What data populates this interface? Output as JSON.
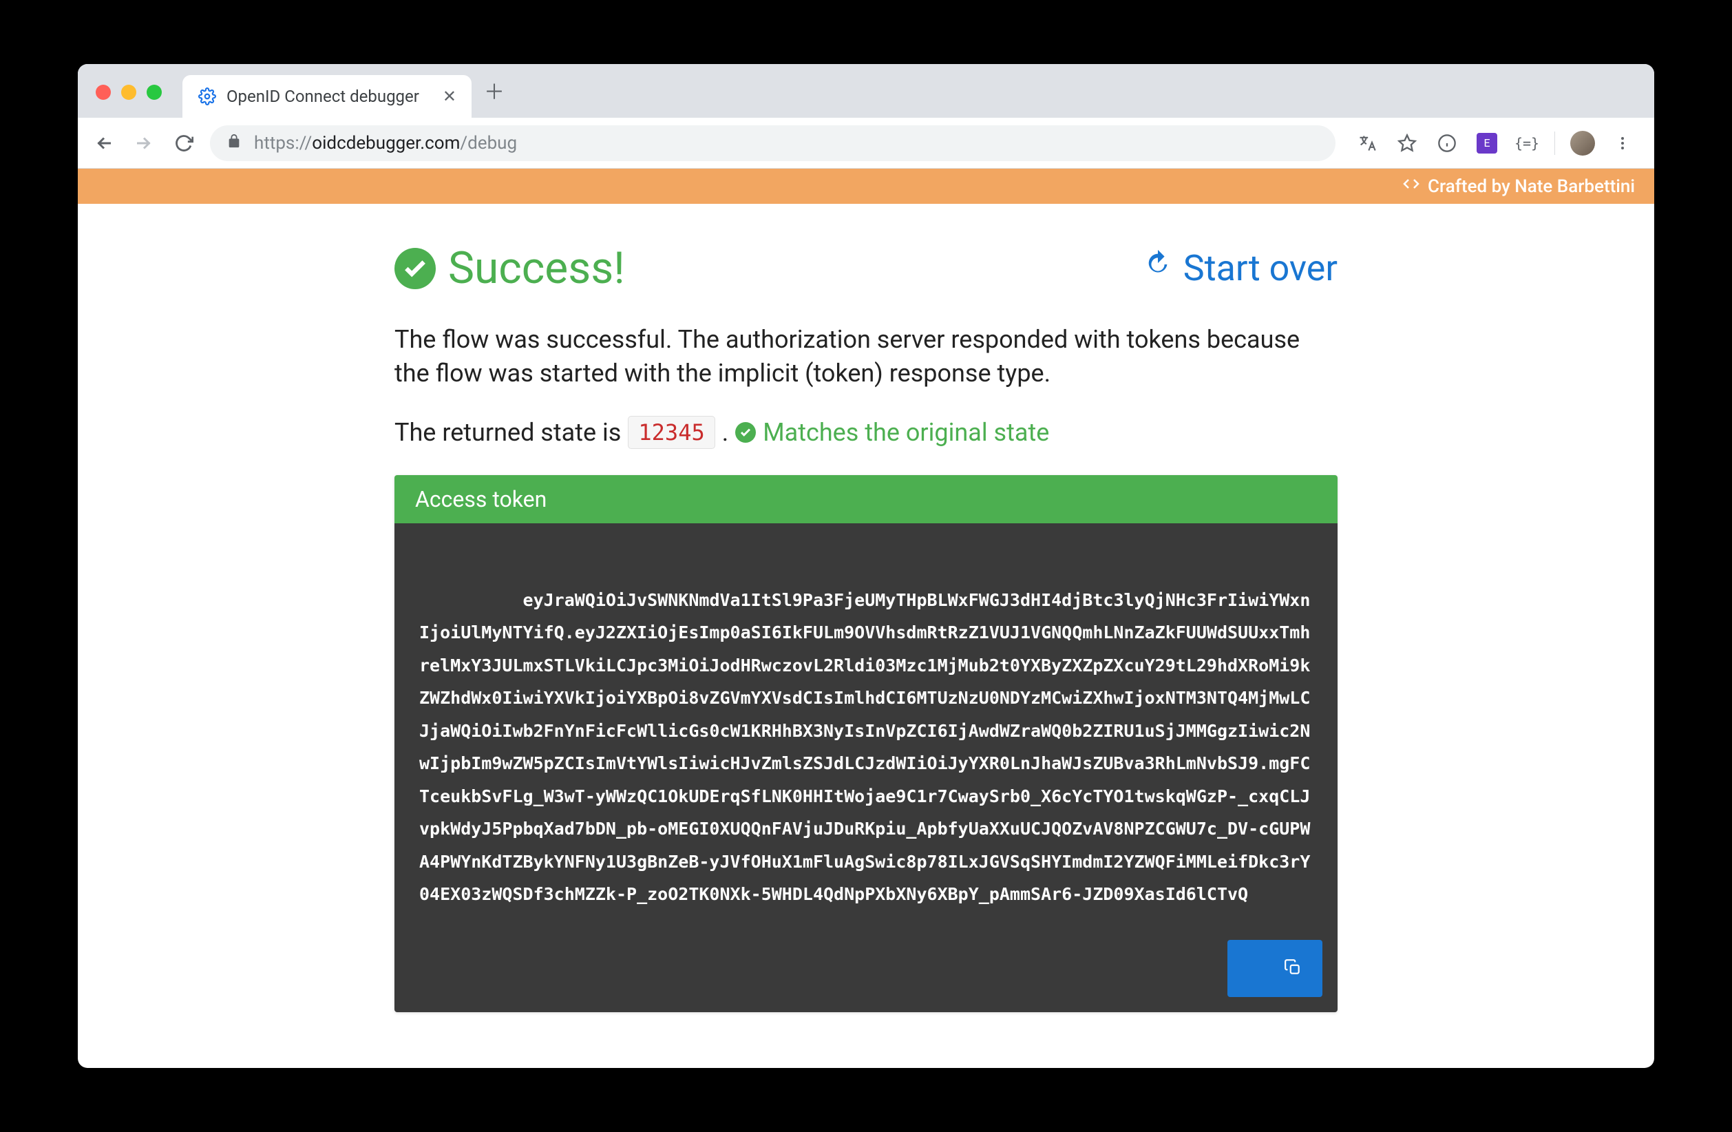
{
  "browser": {
    "tab_title": "OpenID Connect debugger",
    "url_scheme": "https://",
    "url_host": "oidcdebugger.com",
    "url_path": "/debug"
  },
  "topband": {
    "label": "Crafted by Nate Barbettini"
  },
  "header": {
    "success_label": "Success!",
    "start_over_label": "Start over"
  },
  "body": {
    "paragraph": "The flow was successful. The authorization server responded with tokens because the flow was started with the implicit (token) response type.",
    "state_prefix": "The returned state is",
    "state_value": "12345",
    "state_suffix": ".",
    "state_match_label": "Matches the original state"
  },
  "token": {
    "header_label": "Access token",
    "value": "eyJraWQiOiJvSWNKNmdVa1ItSl9Pa3FjeUMyTHpBLWxFWGJ3dHI4djBtc3lyQjNHc3FrIiwiYWxnIjoiUlMyNTYifQ.eyJ2ZXIiOjEsImp0aSI6IkFULm9OVVhsdmRtRzZ1VUJ1VGNQQmhLNnZaZkFUUWdSUUxxTmhrelMxY3JULmxSTLVkiLCJpc3MiOiJodHRwczovL2Rldi03Mzc1MjMub2t0YXByZXZpZXcuY29tL29hdXRoMi9kZWZhdWx0IiwiYXVkIjoiYXBpOi8vZGVmYXVsdCIsImlhdCI6MTUzNzU0NDYzMCwiZXhwIjoxNTM3NTQ4MjMwLCJjaWQiOiIwb2FnYnFicFcWllicGs0cW1KRHhBX3NyIsInVpZCI6IjAwdWZraWQ0b2ZIRU1uSjJMMGgzIiwic2NwIjpbIm9wZW5pZCIsImVtYWlsIiwicHJvZmlsZSJdLCJzdWIiOiJyYXR0LnJhaWJsZUBva3RhLmNvbSJ9.mgFCTceukbSvFLg_W3wT-yWWzQC1OkUDErqSfLNK0HHItWojae9C1r7CwaySrb0_X6cYcTYO1twskqWGzP-_cxqCLJvpkWdyJ5PpbqXad7bDN_pb-oMEGI0XUQQnFAVjuJDuRKpiu_ApbfyUaXXuUCJQOZvAV8NPZCGWU7c_DV-cGUPWA4PWYnKdTZBykYNFNy1U3gBnZeB-yJVfOHuX1mFluAgSwic8p78ILxJGVSqSHYImdmI2YZWQFiMMLeifDkc3rY04EX03zWQSDf3chMZZk-P_zoO2TK0NXk-5WHDL4QdNpPXbXNy6XBpY_pAmmSAr6-JZD09XasId6lCTvQ"
  }
}
